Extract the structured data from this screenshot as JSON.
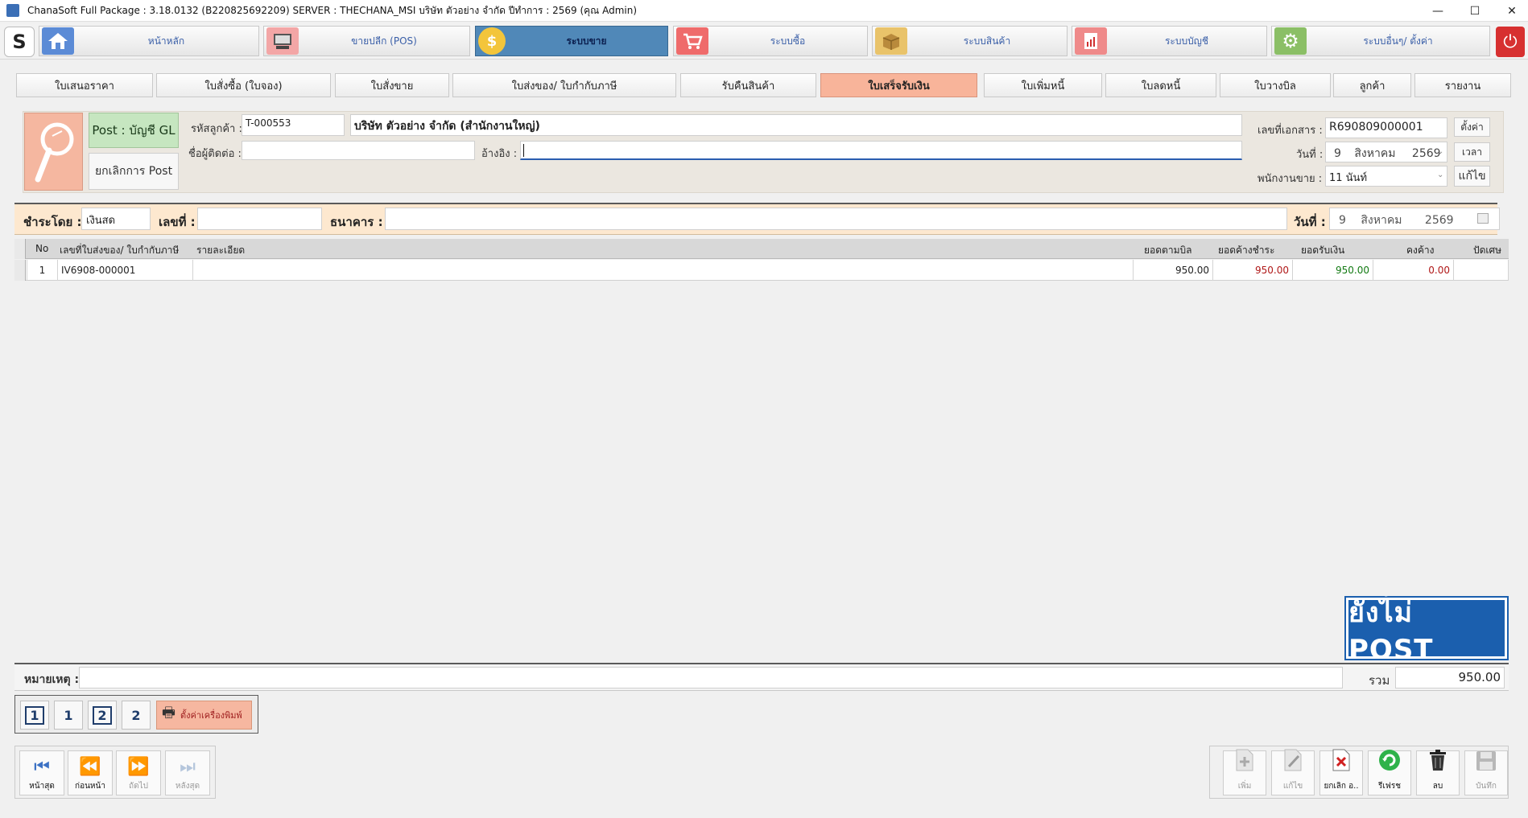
{
  "window": {
    "title": "ChanaSoft Full Package : 3.18.0132 (B220825692209) SERVER : THECHANA_MSI บริษัท ตัวอย่าง จำกัด ปีทำการ : 2569 (คุณ Admin)",
    "minimize": "—",
    "maximize": "☐",
    "close": "✕"
  },
  "modules": [
    {
      "label": "หน้าหลัก",
      "icon": "home-icon",
      "color": "#5b8bd6"
    },
    {
      "label": "ขายปลีก (POS)",
      "icon": "pos-terminal-icon",
      "color": "#f3a6a6"
    },
    {
      "label": "ระบบขาย",
      "icon": "coin-icon",
      "color": "#f3c53b",
      "active": true
    },
    {
      "label": "ระบบซื้อ",
      "icon": "cart-icon",
      "color": "#ef6b6b"
    },
    {
      "label": "ระบบสินค้า",
      "icon": "box-icon",
      "color": "#e9c36a"
    },
    {
      "label": "ระบบบัญชี",
      "icon": "report-icon",
      "color": "#ef8a8a"
    },
    {
      "label": "ระบบอื่นๆ/ ตั้งค่า",
      "icon": "gear-icon",
      "color": "#8bbf66"
    }
  ],
  "tabs": [
    {
      "label": "ใบเสนอราคา"
    },
    {
      "label": "ใบสั่งซื้อ (ใบจอง)"
    },
    {
      "label": "ใบสั่งขาย"
    },
    {
      "label": "ใบส่งของ/ ใบกำกับภาษี"
    },
    {
      "label": "รับคืนสินค้า"
    },
    {
      "label": "ใบเสร็จรับเงิน",
      "active": true
    },
    {
      "label": "ใบเพิ่มหนี้"
    },
    {
      "label": "ใบลดหนี้"
    },
    {
      "label": "ใบวางบิล"
    },
    {
      "label": "ลูกค้า"
    },
    {
      "label": "รายงาน"
    }
  ],
  "header": {
    "post_label": "Post : บัญชี GL",
    "cancel_post_label": "ยกเลิกการ Post",
    "customer_code_label": "รหัสลูกค้า :",
    "customer_code": "T-000553",
    "customer_name": "บริษัท ตัวอย่าง จำกัด (สำนักงานใหญ่)",
    "contact_label": "ชื่อผู้ติดต่อ :",
    "contact": "",
    "reference_label": "อ้างอิง :",
    "reference": "",
    "doc_no_label": "เลขที่เอกสาร :",
    "doc_no": "R690809000001",
    "settings_btn": "ตั้งค่า",
    "date_label": "วันที่ :",
    "date_day": "9",
    "date_month": "สิงหาคม",
    "date_year": "2569",
    "time_btn": "เวลา",
    "salesperson_label": "พนักงานขาย :",
    "salesperson": "11 นันท์",
    "edit_btn": "แก้ไข"
  },
  "payment": {
    "pay_by_label": "ชำระโดย :",
    "pay_by": "เงินสด",
    "number_label": "เลขที่ :",
    "number": "",
    "bank_label": "ธนาคาร :",
    "bank": "",
    "date_label": "วันที่ :",
    "date_day": "9",
    "date_month": "สิงหาคม",
    "date_year": "2569"
  },
  "grid": {
    "columns": [
      "No",
      "เลขที่ใบส่งของ/ ใบกำกับภาษี",
      "รายละเอียด",
      "ยอดตามบิล",
      "ยอดค้างชำระ",
      "ยอดรับเงิน",
      "คงค้าง",
      "ปัดเศษ"
    ],
    "rows": [
      {
        "no": "1",
        "invoice": "IV6908-000001",
        "detail": "",
        "bill_amount": "950.00",
        "outstanding": "950.00",
        "received": "950.00",
        "remaining": "0.00",
        "rounding": ""
      }
    ],
    "colors": {
      "outstanding": "#b01818",
      "received": "#127a12",
      "remaining": "#b01818"
    }
  },
  "status_badge": "ยังไม่ POST",
  "remark": {
    "label": "หมายเหตุ :",
    "value": "",
    "total_label": "รวม",
    "total": "950.00"
  },
  "print": {
    "buttons": [
      "1",
      "1",
      "2",
      "2"
    ],
    "settings_label": "ตั้งค่าเครื่องพิมพ์"
  },
  "nav": [
    {
      "label": "หน้าสุด",
      "icon": "⏮"
    },
    {
      "label": "ก่อนหน้า",
      "icon": "⏪"
    },
    {
      "label": "ถัดไป",
      "icon": "⏩"
    },
    {
      "label": "หลังสุด",
      "icon": "⏭"
    }
  ],
  "actions": [
    {
      "label": "เพิ่ม",
      "icon": "add-document-icon"
    },
    {
      "label": "แก้ไข",
      "icon": "edit-document-icon"
    },
    {
      "label": "ยกเลิก อ..",
      "icon": "cancel-document-icon"
    },
    {
      "label": "รีเฟรช",
      "icon": "refresh-icon"
    },
    {
      "label": "ลบ",
      "icon": "trash-icon"
    },
    {
      "label": "บันทึก",
      "icon": "save-icon"
    }
  ]
}
